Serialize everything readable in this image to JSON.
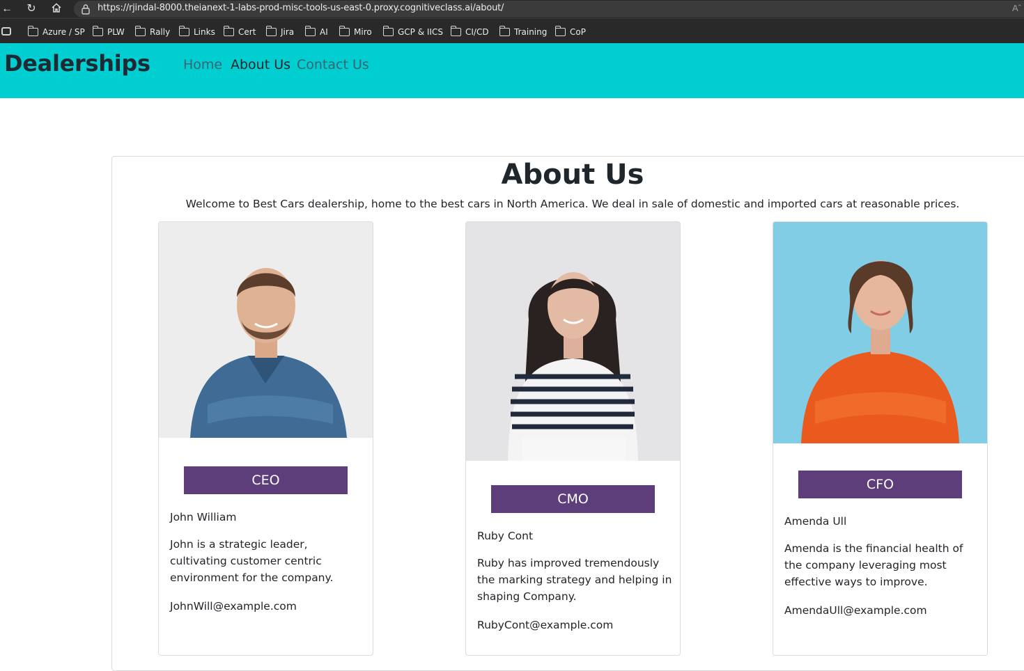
{
  "browser": {
    "url": "https://rjindal-8000.theianext-1-labs-prod-misc-tools-us-east-0.proxy.cognitiveclass.ai/about/",
    "bookmarks": [
      "Azure / SP",
      "PLW",
      "Rally",
      "Links",
      "Cert",
      "Jira",
      "AI",
      "Miro",
      "GCP & IICS",
      "CI/CD",
      "Training",
      "CoP"
    ],
    "read_aloud": "Aˆ"
  },
  "navbar": {
    "brand": "Dealerships",
    "links": [
      "Home",
      "About Us",
      "Contact Us"
    ],
    "active_link": "About Us",
    "bg_color": "#00ced1"
  },
  "page": {
    "title": "About Us",
    "welcome": "Welcome to Best Cars dealership, home to the best cars in North America. We deal in sale of domestic and imported cars at reasonable prices."
  },
  "team": [
    {
      "role": "CEO",
      "name": "John William",
      "description": "John is a strategic leader, cultivating customer centric environment for the company.",
      "email": "JohnWill@example.com",
      "photo": "portrait-man-denim-shirt"
    },
    {
      "role": "CMO",
      "name": "Ruby Cont",
      "description": "Ruby has improved tremendously the marking strategy and helping in shaping Company.",
      "email": "RubyCont@example.com",
      "photo": "portrait-woman-striped-top"
    },
    {
      "role": "CFO",
      "name": "Amenda Ull",
      "description": "Amenda is the financial health of the company leveraging most effective ways to improve.",
      "email": "AmendaUll@example.com",
      "photo": "portrait-woman-orange-shirt"
    }
  ],
  "colors": {
    "badge": "#5e3d7b",
    "chrome": "#292929"
  }
}
